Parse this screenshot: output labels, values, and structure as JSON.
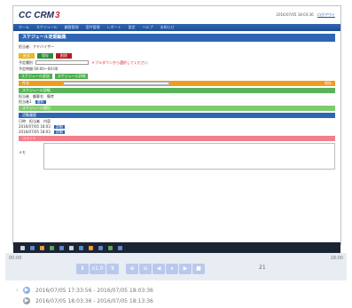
{
  "app": {
    "logo_text": "CC CRM",
    "logo_suffix": "3",
    "user_info": "2016/07/05 18:03:36",
    "logout_link": "ログアウト"
  },
  "nav": {
    "items": [
      "ホーム",
      "スケジュール",
      "顧客管理",
      "案件管理",
      "レポート",
      "設定",
      "ヘルプ",
      "お知らせ"
    ]
  },
  "page": {
    "title": "スケジュール定期編集",
    "field_label": "担当者：アドバイザー",
    "buttons": {
      "yellow": "戻る",
      "green": "保存",
      "red": "削除"
    },
    "line1_label": "予定種別",
    "line1_warn": "＊プルダウンから選択してください",
    "line2_label": "予定時間 00:00〜00:00",
    "green_buttons": [
      "スケジュール追加",
      "スケジュール詳細"
    ],
    "orange_bar_label": "件名",
    "orange_bar_right": "保存",
    "green_bar_label": "スケジュール詳細",
    "table_header": [
      "担当者",
      "顧客名",
      "備考"
    ],
    "row1": {
      "text": "担当者1",
      "btn": "選択"
    },
    "lgreen_bar_label": "スケジュール種別",
    "blue_bar_label": "活動履歴",
    "table_header2": [
      "日時",
      "担当者",
      "内容"
    ],
    "rows": [
      {
        "text": "2016/07/05 18:03",
        "btn": "詳細"
      },
      {
        "text": "2016/07/05 18:03",
        "btn": "詳細"
      }
    ],
    "pink_bar_label": "コメント",
    "memo_label": "メモ"
  },
  "player": {
    "time_start": "00:00",
    "time_end": "18:00",
    "speed": "x1.0",
    "page": "21"
  },
  "clips": [
    {
      "label": "2016/07/05 17:33:56 - 2016/07/05 18:03:36",
      "active": true
    },
    {
      "label": "2016/07/05 18:03:36 - 2016/07/05 18:13:36",
      "active": false
    }
  ],
  "colors": {
    "accent": "#2f66b3",
    "green": "#59b35a",
    "orange": "#ef9d20",
    "pink": "#f27f8a",
    "player_bg": "#e8ecf3"
  }
}
